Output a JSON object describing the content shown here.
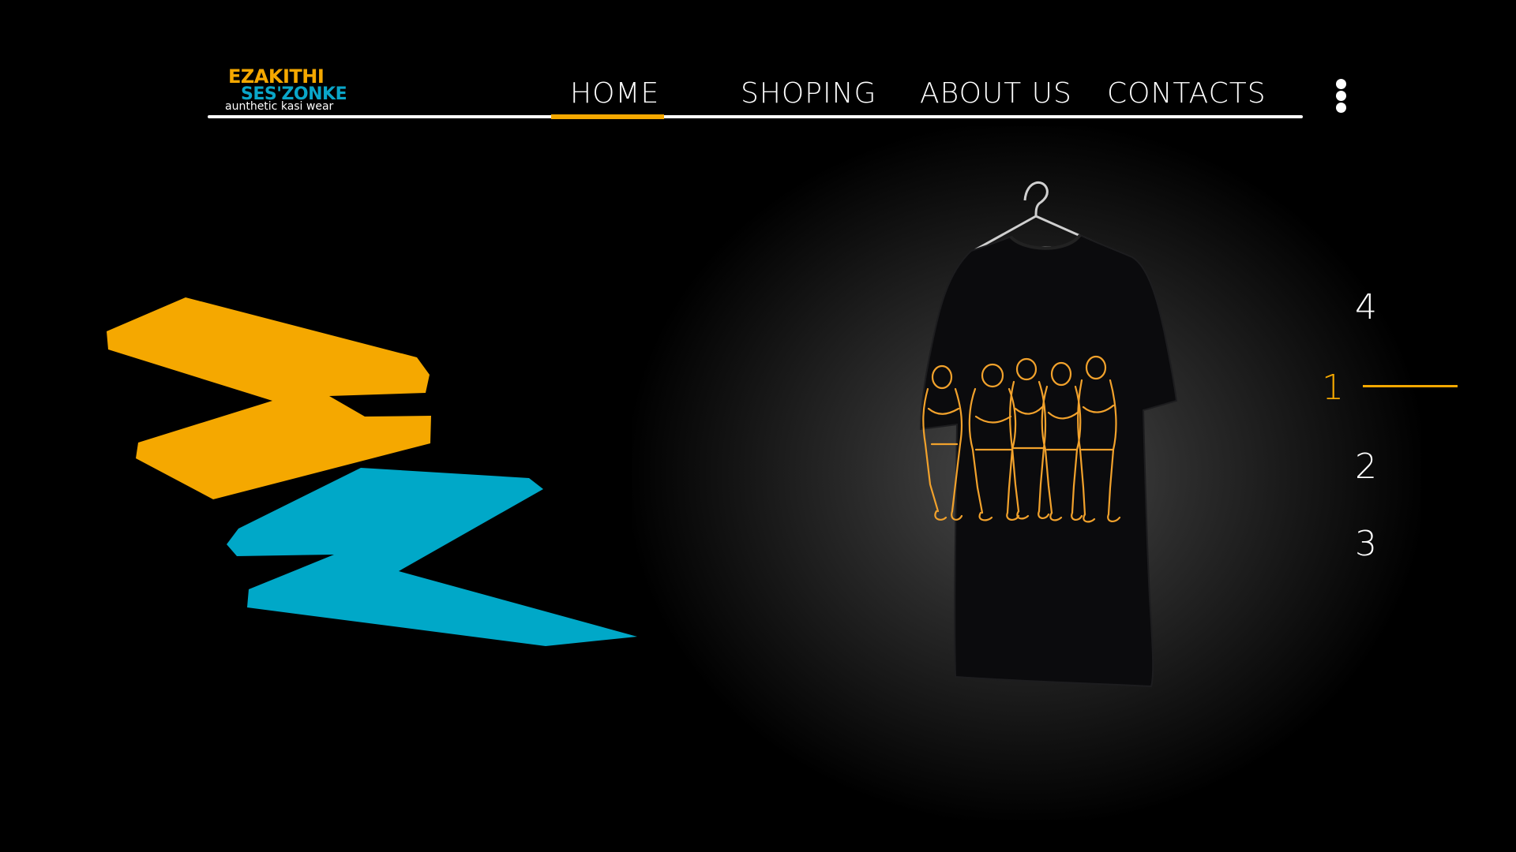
{
  "brand": {
    "line1": "EZAKITHI",
    "line2": "SES'ZONKE",
    "tagline": "aunthetic kasi wear",
    "color_orange": "#f5a800",
    "color_blue": "#0aa6c9"
  },
  "nav": {
    "items": [
      {
        "label": "HOME",
        "active": true
      },
      {
        "label": "SHOPING",
        "active": false
      },
      {
        "label": "ABOUT US",
        "active": false
      },
      {
        "label": "CONTACTS",
        "active": false
      }
    ],
    "menu_icon": "more-vertical-icon"
  },
  "hero": {
    "product_image": "black-tshirt-on-hanger",
    "graphic": "group-of-people-line-art"
  },
  "pager": {
    "items": [
      "4",
      "1",
      "2",
      "3"
    ],
    "active": "1"
  },
  "colors": {
    "accent": "#f5a800",
    "secondary": "#00a8c8",
    "background": "#000000",
    "text": "#ffffff"
  }
}
